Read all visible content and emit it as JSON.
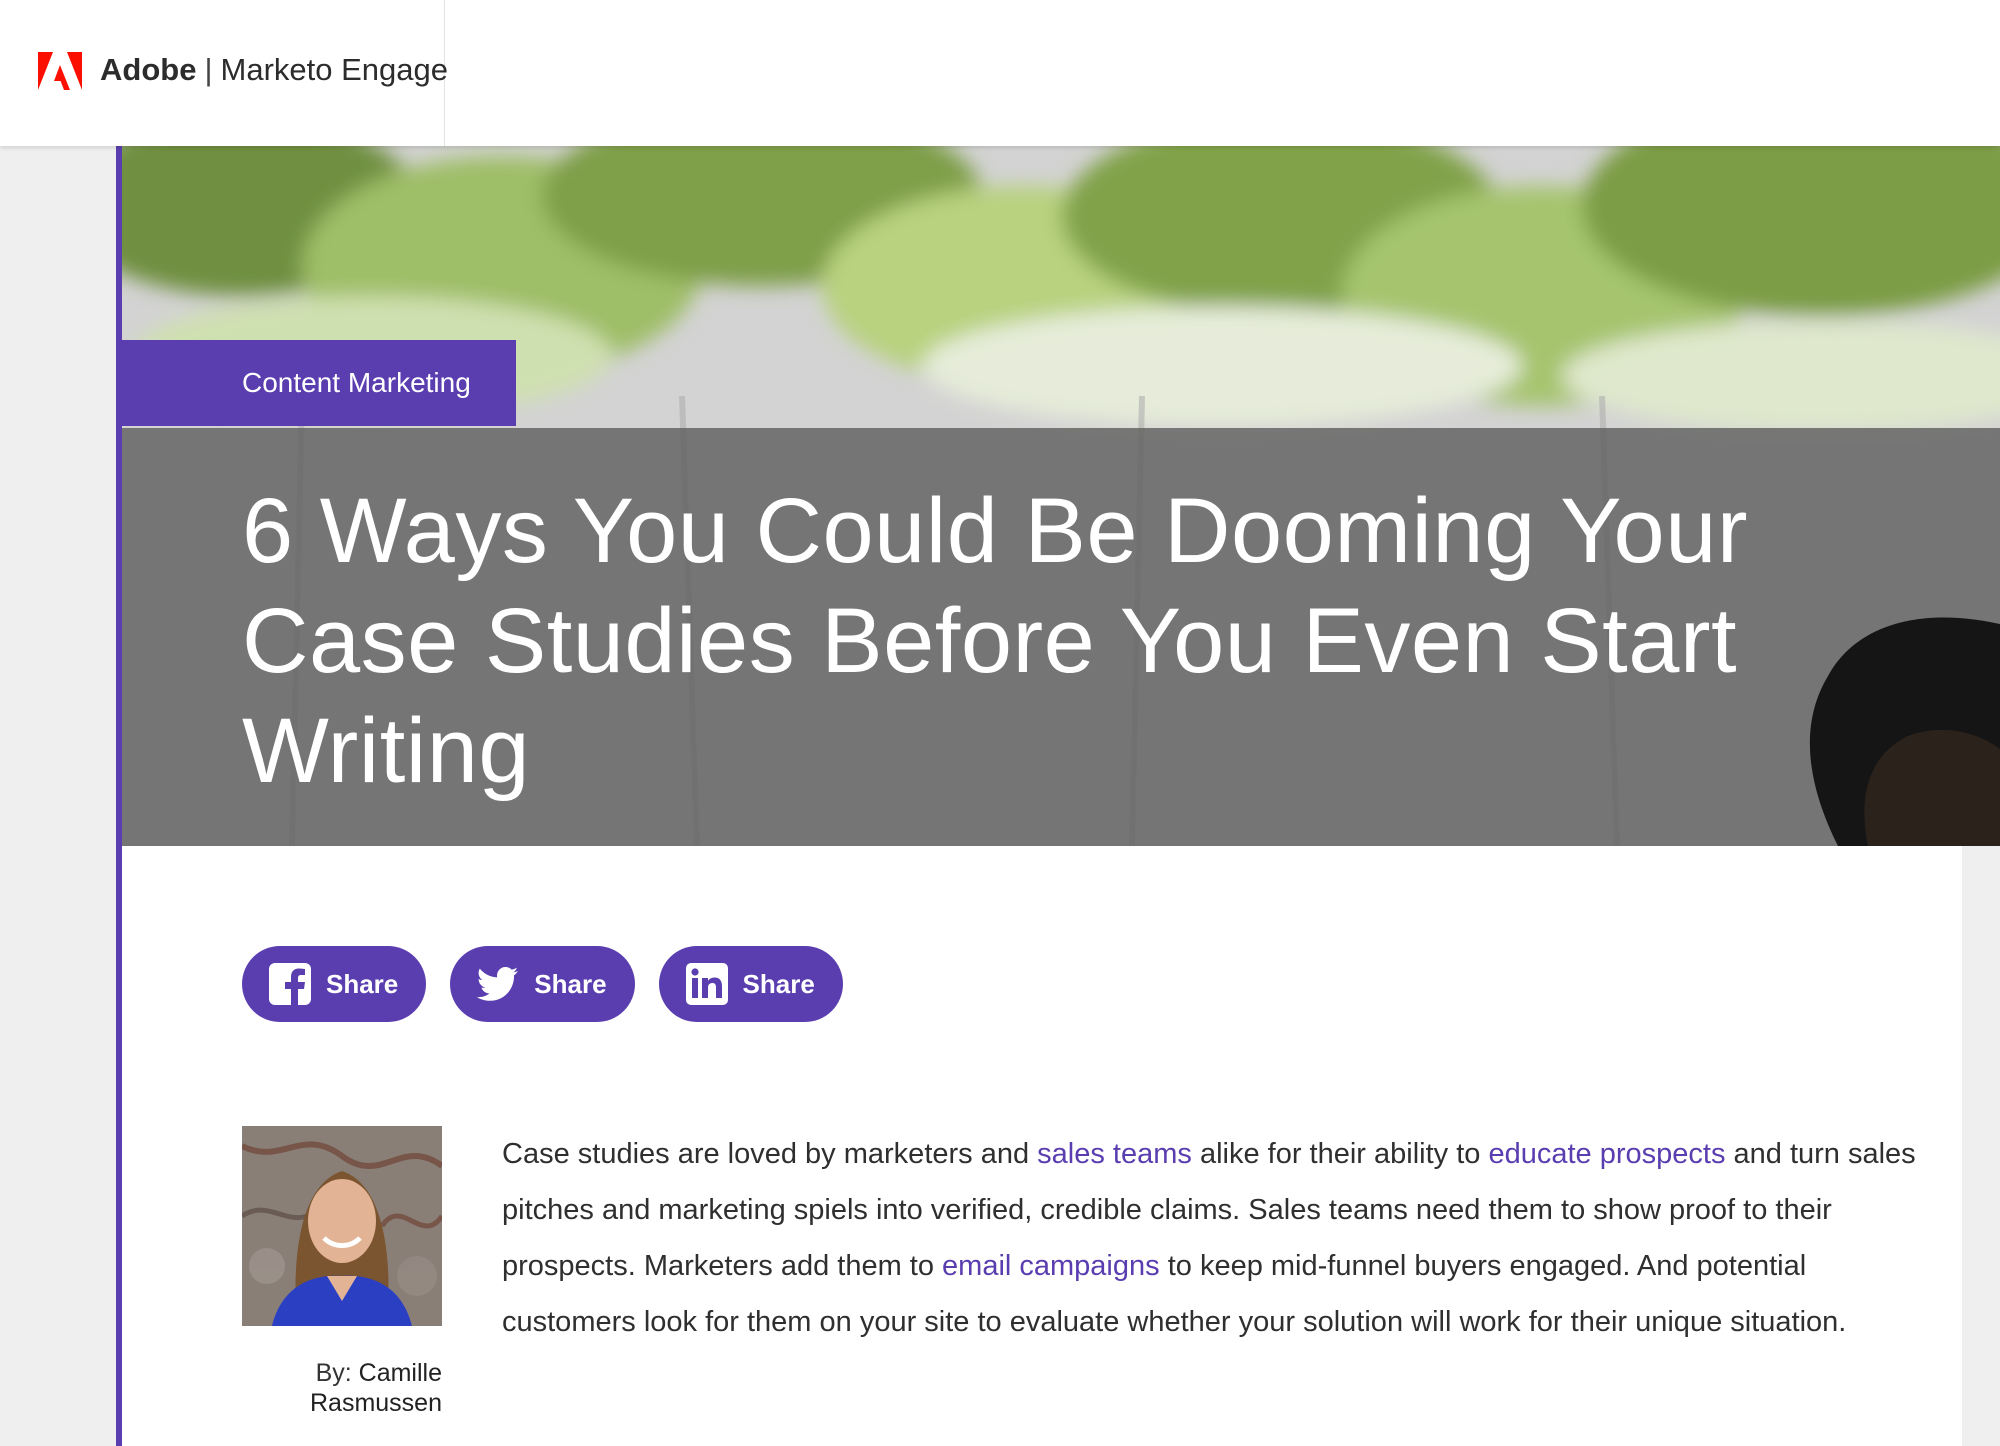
{
  "header": {
    "brand_adobe": "Adobe",
    "brand_separator": "|",
    "brand_product": "Marketo Engage",
    "logo_icon": "adobe-logo-icon",
    "logo_color": "#fa0f00"
  },
  "hero": {
    "category": "Content Marketing",
    "title": "6 Ways You Could Be Dooming Your Case Studies Before You Even Start Writing"
  },
  "share": {
    "facebook_label": "Share",
    "twitter_label": "Share",
    "linkedin_label": "Share",
    "facebook_icon": "facebook-icon",
    "twitter_icon": "twitter-icon",
    "linkedin_icon": "linkedin-icon"
  },
  "author": {
    "by_label": "By:",
    "name": "Camille Rasmussen"
  },
  "body": {
    "p1_a": "Case studies are loved by marketers and ",
    "link_sales_teams": "sales teams",
    "p1_b": " alike for their ability to ",
    "link_educate_prospects": "educate prospects",
    "p1_c": " and turn sales pitches and marketing spiels into verified, credible claims. Sales teams need them to show proof to their prospects. Marketers add them to ",
    "link_email_campaigns": "email campaigns",
    "p1_d": " to keep mid-funnel buyers engaged. And potential customers look for them on your site to evaluate whether your solution will work for their unique situation."
  },
  "colors": {
    "accent": "#5a3eb0",
    "title_band": "#606060",
    "text": "#2f2f2f"
  }
}
